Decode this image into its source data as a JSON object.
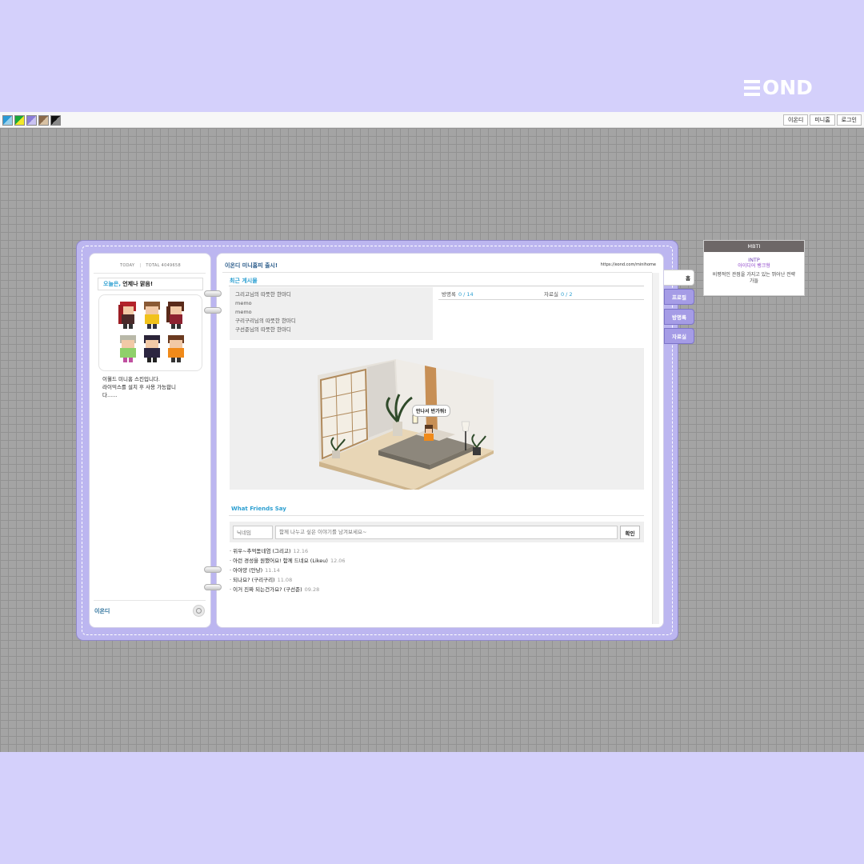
{
  "brand": {
    "text": "OND"
  },
  "toolbar": {
    "swatches": [
      {
        "name": "theme-swatch-blue",
        "colors": [
          "#2b9ad6",
          "#9ad1ec"
        ]
      },
      {
        "name": "theme-swatch-green",
        "colors": [
          "#1aa83a",
          "#f2e82b"
        ]
      },
      {
        "name": "theme-swatch-purple",
        "colors": [
          "#8b7ed8",
          "#c9c3f2"
        ]
      },
      {
        "name": "theme-swatch-brown",
        "colors": [
          "#8a6a4a",
          "#d8c2a4"
        ]
      },
      {
        "name": "theme-swatch-black",
        "colors": [
          "#111111",
          "#8a8a8a"
        ]
      }
    ],
    "buttons": [
      "이온디",
      "미니홈",
      "로그인"
    ]
  },
  "left": {
    "today_label": "TODAY",
    "total_label": "TOTAL 4049658",
    "mood_label": "오늘은,",
    "mood_text": "언제나 맑음!",
    "intro": "이월드 미니홈 스킨입니다.\n라이믹스를 설치 후 사용 가능합니다......",
    "owner": "이온디"
  },
  "right": {
    "title": "이온디 미니홈피 출시!",
    "url": "https://eond.com/minihome",
    "recent_title": "최근 게시물",
    "recent_posts": [
      "그리고님의 따뜻한 한마디",
      "memo",
      "memo",
      "구리구리님의 따뜻한 한마디",
      "구선준님의 따뜻한 한마디"
    ],
    "stats": [
      {
        "label": "방명록",
        "value": "0 / 14"
      },
      {
        "label": "자료실",
        "value": "0 / 2"
      }
    ],
    "room_bubble": "만나서 반가워!",
    "friends_title": "What Friends Say",
    "nick_placeholder": "닉네임",
    "msg_placeholder": "함께 나누고 싶은 이야기를 남겨보세요~",
    "ok_label": "확인",
    "comments": [
      {
        "text": "· 위우~추억돋네염 (그리고)",
        "date": "12.16"
      },
      {
        "text": "· 아런 경성을 원했어요! 함께 드네요 (Likeu)",
        "date": "12.06"
      },
      {
        "text": "· 아야양 (안냥)",
        "date": "11.14"
      },
      {
        "text": "· 되나요? (구리구리)",
        "date": "11.08"
      },
      {
        "text": "· 이거 진짜 되는건가요? (구선준)",
        "date": "09.28"
      }
    ]
  },
  "tabs": [
    "홈",
    "프로필",
    "방명록",
    "자료실"
  ],
  "mbti": {
    "header": "MBTI",
    "type": "INTP",
    "alias": "아이디어 뱅크형",
    "desc": "비평적인 관점을 가지고 있는 뛰어난 전략가들"
  },
  "colors": {
    "background": "#d4d0fb",
    "book": "#bcb6f0",
    "accent": "#2c9fd1",
    "tab": "#a59ce6"
  }
}
